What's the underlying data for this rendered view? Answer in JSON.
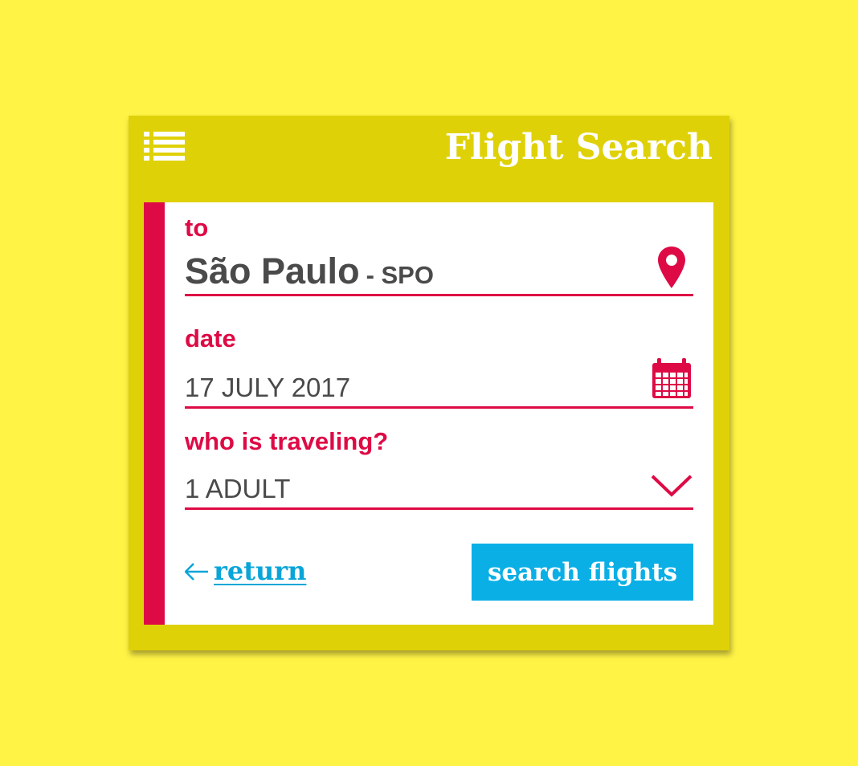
{
  "colors": {
    "page_background": "#fff346",
    "panel": "#dfd108",
    "accent": "#de0a45",
    "text": "#4a4a4a",
    "link": "#0aa5d8",
    "button": "#0aafe6",
    "white": "#ffffff"
  },
  "header": {
    "title": "Flight Search",
    "menu_icon": "list-icon"
  },
  "form": {
    "destination": {
      "label": "to",
      "city": "São Paulo",
      "code": "- SPO",
      "icon": "location-pin-icon"
    },
    "date": {
      "label": "date",
      "value": "17 JULY 2017",
      "icon": "calendar-icon"
    },
    "travelers": {
      "label": "who is traveling?",
      "value": "1 ADULT",
      "icon": "chevron-down-icon"
    }
  },
  "actions": {
    "return_label": "return",
    "return_icon": "arrow-left-icon",
    "search_label": "search flights"
  }
}
